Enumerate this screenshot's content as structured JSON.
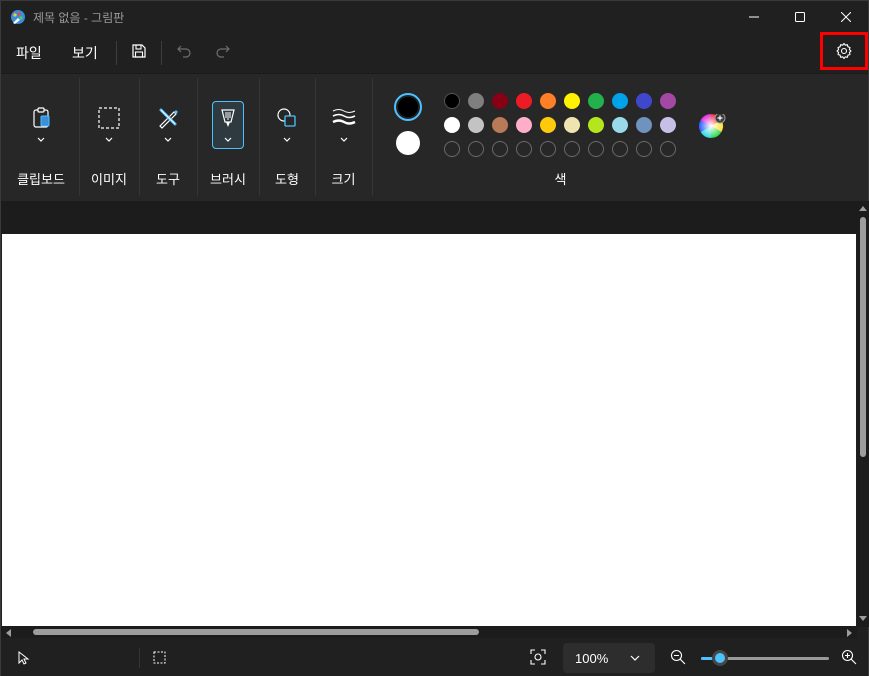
{
  "window": {
    "title": "제목 없음 - 그림판"
  },
  "menu": {
    "file": "파일",
    "view": "보기"
  },
  "ribbon": {
    "groups": [
      {
        "label": "클립보드",
        "icon": "clipboard-icon"
      },
      {
        "label": "이미지",
        "icon": "image-select-icon"
      },
      {
        "label": "도구",
        "icon": "tools-icon"
      },
      {
        "label": "브러시",
        "icon": "brush-icon"
      },
      {
        "label": "도형",
        "icon": "shapes-icon"
      },
      {
        "label": "크기",
        "icon": "size-icon"
      }
    ],
    "colors_label": "색",
    "color1": "#000000",
    "color2": "#ffffff",
    "palette_row1": [
      "#000000",
      "#7f7f7f",
      "#880015",
      "#ed1c24",
      "#ff7f27",
      "#fff200",
      "#22b14c",
      "#00a2e8",
      "#3f48cc",
      "#a349a4"
    ],
    "palette_row2": [
      "#ffffff",
      "#c3c3c3",
      "#b97a57",
      "#ffaec9",
      "#ffc90e",
      "#efe4b0",
      "#b5e61d",
      "#99d9ea",
      "#7092be",
      "#c8bfe7"
    ]
  },
  "status": {
    "zoom": "100%",
    "zoom_level": 0.15
  },
  "colors": {
    "accent": "#4cc2ff",
    "highlight": "#ff0000"
  }
}
